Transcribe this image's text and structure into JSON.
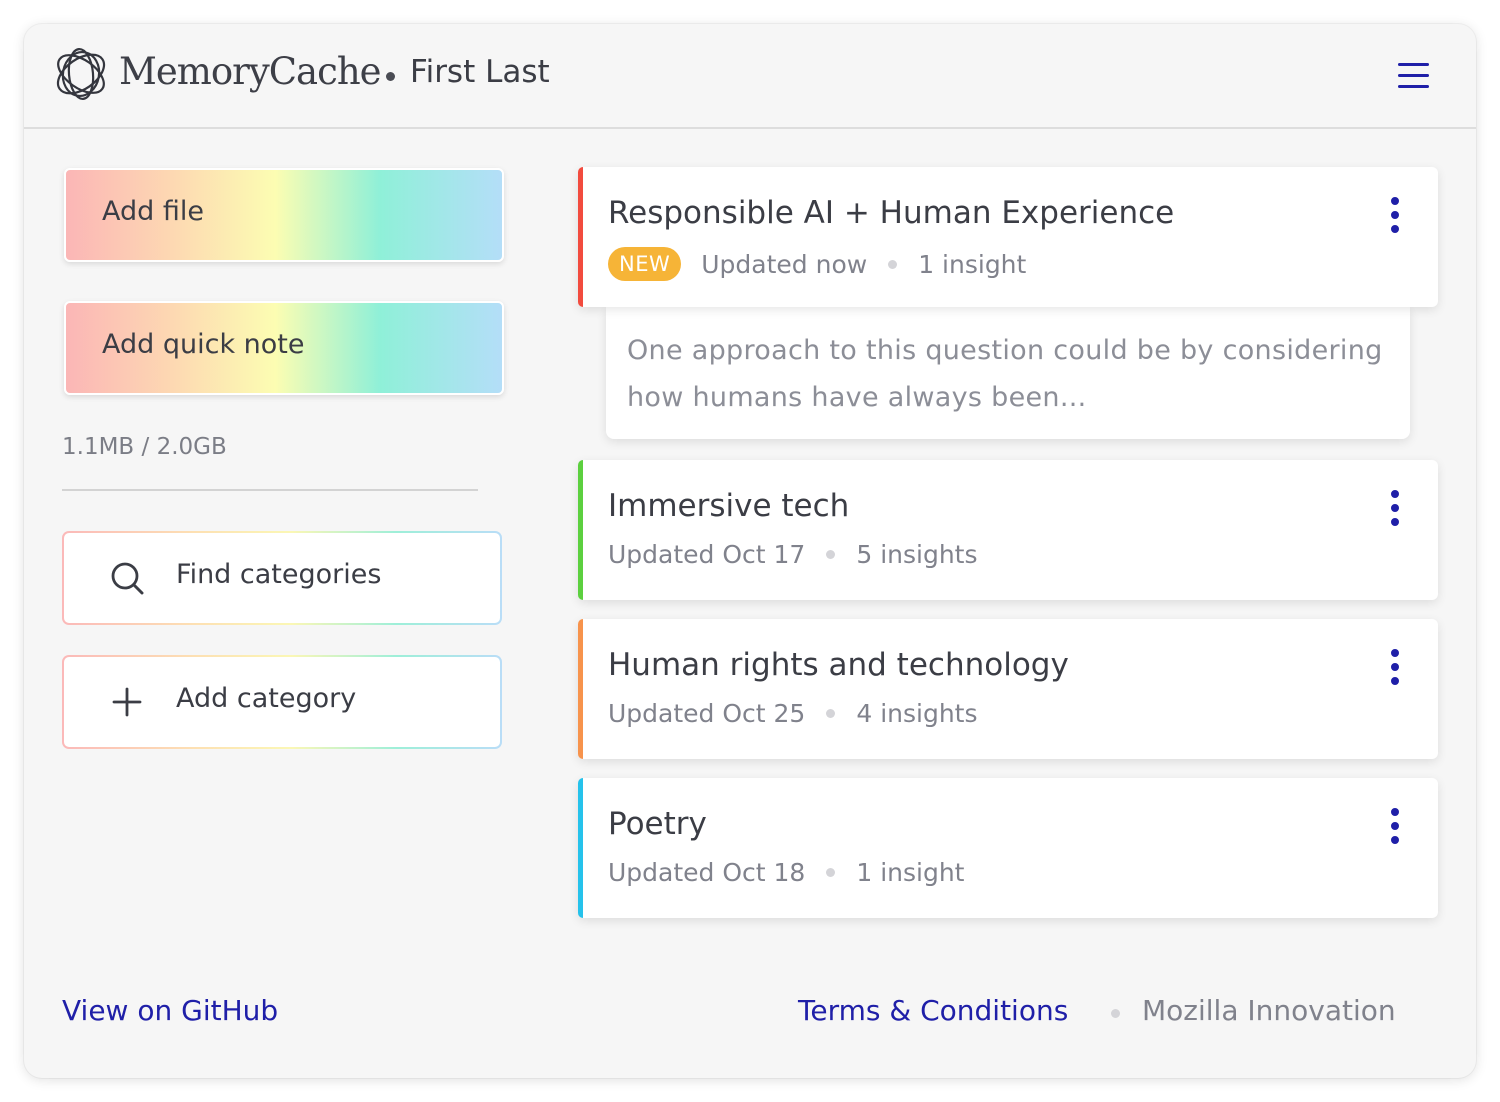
{
  "header": {
    "brand": "MemoryCache",
    "user": "First Last",
    "logo_icon": "memorycache-logo-icon",
    "menu_icon": "hamburger-menu-icon"
  },
  "sidebar": {
    "add_file_label": "Add file",
    "add_note_label": "Add quick note",
    "storage_used": "1.1MB / 2.0GB",
    "find_categories_label": "Find categories",
    "add_category_label": "Add category",
    "find_icon": "search-icon",
    "add_icon": "plus-icon"
  },
  "categories": [
    {
      "title": "Responsible AI + Human Experience",
      "badge": "NEW",
      "updated": "Updated now",
      "insights": "1 insight",
      "accent": "#f24b3e"
    },
    {
      "title": "Immersive tech",
      "updated": "Updated Oct 17",
      "insights": "5 insights",
      "accent": "#5cd03f"
    },
    {
      "title": "Human rights and technology",
      "updated": "Updated Oct 25",
      "insights": "4 insights",
      "accent": "#f7934c"
    },
    {
      "title": "Poetry",
      "updated": "Updated Oct 18",
      "insights": "1 insight",
      "accent": "#25c2eb"
    }
  ],
  "preview": {
    "text": "One approach to this question could be by considering how humans have always been..."
  },
  "footer": {
    "github": "View on GitHub",
    "terms": "Terms & Conditions",
    "org": "Mozilla Innovation"
  },
  "colors": {
    "link": "#1f1fa8",
    "badge": "#f6b437"
  }
}
